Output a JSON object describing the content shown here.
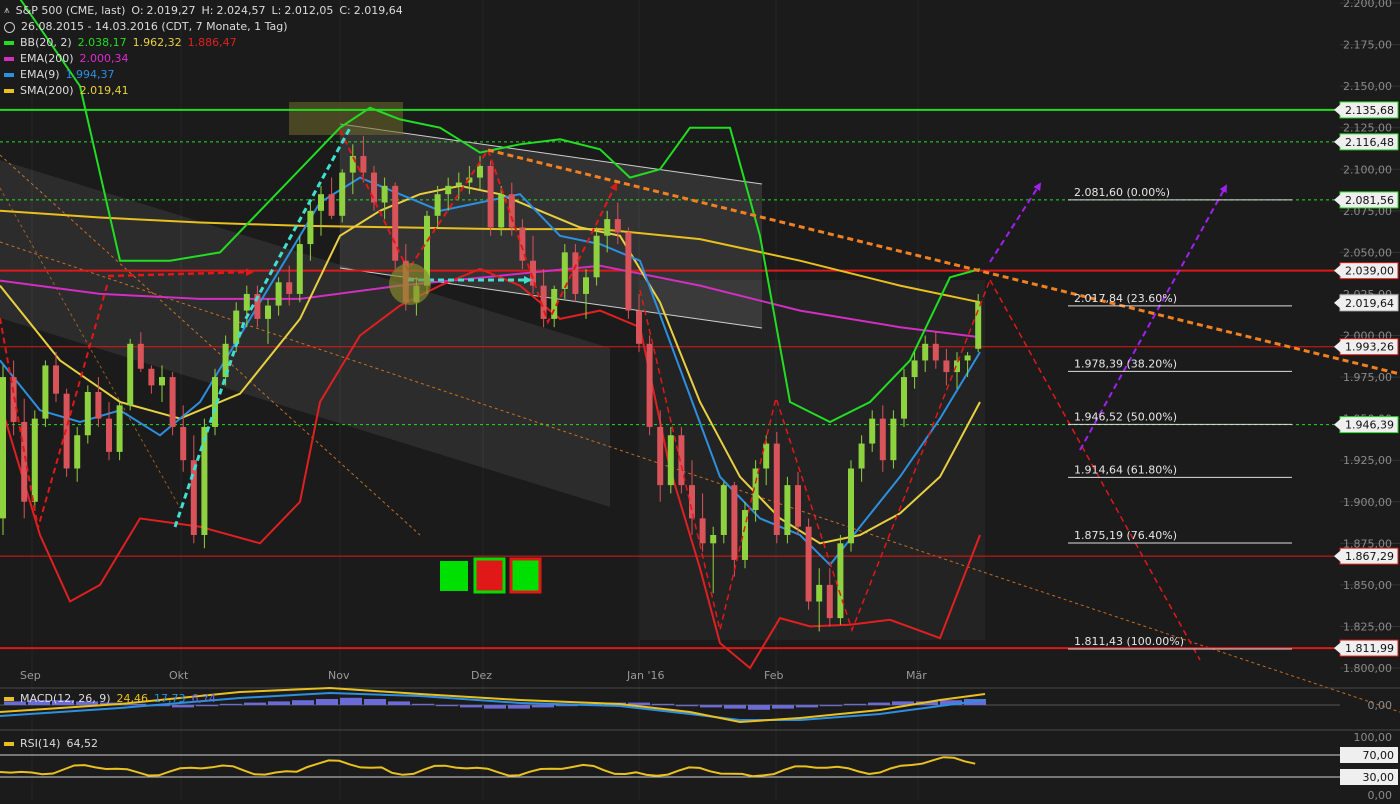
{
  "header": {
    "symbol": "S&P 500 (CME, last)",
    "o_label": "O:",
    "o": "2.019,27",
    "h_label": "H:",
    "h": "2.024,57",
    "l_label": "L:",
    "l": "2.012,05",
    "c_label": "C:",
    "c": "2.019,64",
    "range": "26.08.2015 - 14.03.2016 (CDT, 7 Monate, 1 Tag)"
  },
  "legend": [
    {
      "name": "BB(20, 2)",
      "values": [
        "2.038,17",
        "1.962,32",
        "1.886,47"
      ],
      "colors": [
        "#22dd22",
        "#e8d040",
        "#e02020"
      ],
      "color": "#22dd22"
    },
    {
      "name": "EMA(200)",
      "values": [
        "2.000,34"
      ],
      "colors": [
        "#e02bd0"
      ],
      "color": "#d22fc2"
    },
    {
      "name": "EMA(9)",
      "values": [
        "1.994,37"
      ],
      "colors": [
        "#2d8fe0"
      ],
      "color": "#2d8fe0"
    },
    {
      "name": "SMA(200)",
      "values": [
        "2.019,41"
      ],
      "colors": [
        "#e8d040"
      ],
      "color": "#e8c020"
    }
  ],
  "price_axis": {
    "ticks": [
      "2.200,00",
      "2.175,00",
      "2.150,00",
      "2.125,00",
      "2.100,00",
      "2.075,00",
      "2.050,00",
      "2.025,00",
      "2.000,00",
      "1.975,00",
      "1.950,00",
      "1.925,00",
      "1.900,00",
      "1.875,00",
      "1.850,00",
      "1.825,00",
      "1.800,00"
    ],
    "tick_values": [
      2200,
      2175,
      2150,
      2125,
      2100,
      2075,
      2050,
      2025,
      2000,
      1975,
      1950,
      1925,
      1900,
      1875,
      1850,
      1825,
      1800
    ]
  },
  "price_tags": [
    {
      "value": 2135.68,
      "label": "2.135,68"
    },
    {
      "value": 2116.48,
      "label": "2.116,48"
    },
    {
      "value": 2081.56,
      "label": "2.081,56"
    },
    {
      "value": 2039.0,
      "label": "2.039,00"
    },
    {
      "value": 2019.64,
      "label": "2.019,64"
    },
    {
      "value": 1993.26,
      "label": "1.993,26"
    },
    {
      "value": 1946.39,
      "label": "1.946,39"
    },
    {
      "value": 1867.29,
      "label": "1.867,29"
    },
    {
      "value": 1811.99,
      "label": "1.811,99"
    }
  ],
  "fib_levels": [
    {
      "value": 2081.6,
      "label": "2.081,60 (0.00%)"
    },
    {
      "value": 2017.84,
      "label": "2.017,84 (23.60%)"
    },
    {
      "value": 1978.39,
      "label": "1.978,39 (38.20%)"
    },
    {
      "value": 1946.52,
      "label": "1.946,52 (50.00%)"
    },
    {
      "value": 1914.64,
      "label": "1.914,64 (61.80%)"
    },
    {
      "value": 1875.19,
      "label": "1.875,19 (76.40%)"
    },
    {
      "value": 1811.43,
      "label": "1.811,43 (100.00%)"
    }
  ],
  "time_axis": [
    "Sep",
    "Okt",
    "Nov",
    "Dez",
    "Jan '16",
    "Feb",
    "Mär"
  ],
  "macd": {
    "label": "MACD(12, 26, 9)",
    "values": [
      "24,46",
      "17,73",
      "6,74"
    ],
    "colors": [
      "#e8c020",
      "#2d8fe0",
      "#6b6bd8"
    ],
    "zero_label": "0,00"
  },
  "rsi": {
    "label": "RSI(14)",
    "value": "64,52",
    "levels": [
      "100,00",
      "70,00",
      "30,00",
      "0,00"
    ],
    "color": "#e8c020"
  },
  "colors": {
    "background": "#1b1b1b",
    "up": "#8fd23f",
    "down": "#d9535a",
    "bb": "#22dd22",
    "bb_mid": "#e8d040",
    "bb_low": "#e02020",
    "ema200": "#d22fc2",
    "ema9": "#2d8fe0",
    "sma200": "#e8c020",
    "support": "#e01818",
    "fib_arrow": "#a020f0",
    "trend": "#f08020",
    "cyan": "#40e0d0"
  },
  "chart_data": {
    "type": "candlestick",
    "ylim": [
      1790,
      2200
    ],
    "candles": [
      [
        1890,
        1982,
        1880,
        1975
      ],
      [
        1975,
        1985,
        1940,
        1948
      ],
      [
        1948,
        1962,
        1890,
        1900
      ],
      [
        1900,
        1955,
        1895,
        1950
      ],
      [
        1950,
        1985,
        1945,
        1982
      ],
      [
        1982,
        1990,
        1960,
        1965
      ],
      [
        1965,
        1968,
        1915,
        1920
      ],
      [
        1920,
        1945,
        1912,
        1940
      ],
      [
        1940,
        1970,
        1935,
        1966
      ],
      [
        1966,
        1975,
        1945,
        1950
      ],
      [
        1950,
        1960,
        1925,
        1930
      ],
      [
        1930,
        1960,
        1925,
        1958
      ],
      [
        1958,
        1998,
        1955,
        1995
      ],
      [
        1995,
        2002,
        1978,
        1980
      ],
      [
        1980,
        1982,
        1965,
        1970
      ],
      [
        1970,
        1982,
        1960,
        1975
      ],
      [
        1975,
        1978,
        1940,
        1945
      ],
      [
        1945,
        1958,
        1918,
        1925
      ],
      [
        1925,
        1940,
        1875,
        1880
      ],
      [
        1880,
        1950,
        1872,
        1945
      ],
      [
        1945,
        1980,
        1940,
        1975
      ],
      [
        1975,
        2000,
        1970,
        1995
      ],
      [
        1995,
        2020,
        1990,
        2015
      ],
      [
        2015,
        2030,
        2005,
        2025
      ],
      [
        2025,
        2030,
        2005,
        2010
      ],
      [
        2010,
        2022,
        1995,
        2018
      ],
      [
        2018,
        2035,
        2012,
        2032
      ],
      [
        2032,
        2042,
        2018,
        2025
      ],
      [
        2025,
        2060,
        2020,
        2055
      ],
      [
        2055,
        2080,
        2045,
        2075
      ],
      [
        2075,
        2090,
        2060,
        2085
      ],
      [
        2085,
        2095,
        2070,
        2072
      ],
      [
        2072,
        2100,
        2068,
        2098
      ],
      [
        2098,
        2115,
        2085,
        2108
      ],
      [
        2108,
        2120,
        2092,
        2098
      ],
      [
        2098,
        2102,
        2075,
        2080
      ],
      [
        2080,
        2095,
        2070,
        2090
      ],
      [
        2090,
        2092,
        2040,
        2045
      ],
      [
        2045,
        2055,
        2015,
        2020
      ],
      [
        2020,
        2035,
        2012,
        2030
      ],
      [
        2030,
        2075,
        2025,
        2072
      ],
      [
        2072,
        2090,
        2065,
        2085
      ],
      [
        2085,
        2095,
        2075,
        2090
      ],
      [
        2090,
        2098,
        2082,
        2092
      ],
      [
        2092,
        2102,
        2085,
        2095
      ],
      [
        2095,
        2108,
        2088,
        2102
      ],
      [
        2102,
        2105,
        2060,
        2065
      ],
      [
        2065,
        2090,
        2060,
        2085
      ],
      [
        2085,
        2092,
        2060,
        2065
      ],
      [
        2065,
        2070,
        2040,
        2045
      ],
      [
        2045,
        2060,
        2025,
        2030
      ],
      [
        2030,
        2040,
        2005,
        2010
      ],
      [
        2010,
        2030,
        2005,
        2028
      ],
      [
        2028,
        2055,
        2022,
        2050
      ],
      [
        2050,
        2055,
        2020,
        2025
      ],
      [
        2025,
        2040,
        2010,
        2035
      ],
      [
        2035,
        2065,
        2030,
        2060
      ],
      [
        2060,
        2075,
        2050,
        2070
      ],
      [
        2070,
        2080,
        2055,
        2062
      ],
      [
        2062,
        2065,
        2010,
        2015
      ],
      [
        2015,
        2025,
        1990,
        1995
      ],
      [
        1995,
        2000,
        1940,
        1945
      ],
      [
        1945,
        1955,
        1900,
        1910
      ],
      [
        1910,
        1945,
        1905,
        1940
      ],
      [
        1940,
        1945,
        1905,
        1910
      ],
      [
        1910,
        1925,
        1880,
        1890
      ],
      [
        1890,
        1905,
        1870,
        1875
      ],
      [
        1875,
        1885,
        1845,
        1880
      ],
      [
        1880,
        1912,
        1875,
        1910
      ],
      [
        1910,
        1912,
        1855,
        1865
      ],
      [
        1865,
        1900,
        1860,
        1895
      ],
      [
        1895,
        1925,
        1888,
        1920
      ],
      [
        1920,
        1940,
        1910,
        1935
      ],
      [
        1935,
        1942,
        1875,
        1880
      ],
      [
        1880,
        1915,
        1875,
        1910
      ],
      [
        1910,
        1918,
        1880,
        1885
      ],
      [
        1885,
        1890,
        1835,
        1840
      ],
      [
        1840,
        1860,
        1822,
        1850
      ],
      [
        1850,
        1860,
        1825,
        1830
      ],
      [
        1830,
        1880,
        1826,
        1875
      ],
      [
        1875,
        1925,
        1870,
        1920
      ],
      [
        1920,
        1940,
        1912,
        1935
      ],
      [
        1935,
        1955,
        1930,
        1950
      ],
      [
        1950,
        1958,
        1918,
        1925
      ],
      [
        1925,
        1955,
        1920,
        1950
      ],
      [
        1950,
        1980,
        1945,
        1975
      ],
      [
        1975,
        1990,
        1968,
        1985
      ],
      [
        1985,
        2000,
        1978,
        1995
      ],
      [
        1995,
        2002,
        1980,
        1985
      ],
      [
        1985,
        1992,
        1970,
        1978
      ],
      [
        1978,
        1990,
        1968,
        1985
      ],
      [
        1985,
        1990,
        1975,
        1988
      ],
      [
        1992,
        2025,
        1990,
        2020
      ]
    ],
    "bb_upper": [
      [
        0,
        2220
      ],
      [
        80,
        2150
      ],
      [
        120,
        2045
      ],
      [
        170,
        2045
      ],
      [
        220,
        2050
      ],
      [
        260,
        2075
      ],
      [
        300,
        2100
      ],
      [
        340,
        2125
      ],
      [
        370,
        2137
      ],
      [
        400,
        2130
      ],
      [
        440,
        2125
      ],
      [
        480,
        2110
      ],
      [
        520,
        2115
      ],
      [
        560,
        2118
      ],
      [
        600,
        2112
      ],
      [
        630,
        2095
      ],
      [
        660,
        2100
      ],
      [
        690,
        2125
      ],
      [
        730,
        2125
      ],
      [
        760,
        2060
      ],
      [
        790,
        1960
      ],
      [
        830,
        1948
      ],
      [
        870,
        1960
      ],
      [
        910,
        1985
      ],
      [
        950,
        2035
      ],
      [
        980,
        2040
      ]
    ],
    "bb_lower": [
      [
        0,
        1960
      ],
      [
        40,
        1880
      ],
      [
        70,
        1840
      ],
      [
        100,
        1850
      ],
      [
        140,
        1890
      ],
      [
        200,
        1885
      ],
      [
        260,
        1875
      ],
      [
        300,
        1900
      ],
      [
        320,
        1960
      ],
      [
        360,
        2000
      ],
      [
        400,
        2018
      ],
      [
        440,
        2030
      ],
      [
        480,
        2040
      ],
      [
        520,
        2030
      ],
      [
        560,
        2010
      ],
      [
        600,
        2015
      ],
      [
        640,
        2005
      ],
      [
        670,
        1920
      ],
      [
        700,
        1860
      ],
      [
        720,
        1815
      ],
      [
        750,
        1800
      ],
      [
        780,
        1830
      ],
      [
        810,
        1825
      ],
      [
        850,
        1826
      ],
      [
        890,
        1829
      ],
      [
        940,
        1818
      ],
      [
        980,
        1880
      ]
    ],
    "bb_middle": [
      [
        0,
        2030
      ],
      [
        60,
        1985
      ],
      [
        120,
        1960
      ],
      [
        180,
        1950
      ],
      [
        240,
        1965
      ],
      [
        300,
        2010
      ],
      [
        340,
        2060
      ],
      [
        380,
        2075
      ],
      [
        420,
        2085
      ],
      [
        460,
        2090
      ],
      [
        500,
        2085
      ],
      [
        540,
        2075
      ],
      [
        580,
        2065
      ],
      [
        620,
        2060
      ],
      [
        660,
        2020
      ],
      [
        700,
        1960
      ],
      [
        740,
        1915
      ],
      [
        780,
        1890
      ],
      [
        820,
        1875
      ],
      [
        860,
        1880
      ],
      [
        900,
        1893
      ],
      [
        940,
        1915
      ],
      [
        980,
        1960
      ]
    ],
    "ema9": [
      [
        0,
        1985
      ],
      [
        40,
        1955
      ],
      [
        80,
        1948
      ],
      [
        120,
        1955
      ],
      [
        160,
        1940
      ],
      [
        200,
        1960
      ],
      [
        240,
        2000
      ],
      [
        280,
        2040
      ],
      [
        320,
        2080
      ],
      [
        360,
        2095
      ],
      [
        400,
        2085
      ],
      [
        440,
        2075
      ],
      [
        480,
        2080
      ],
      [
        520,
        2085
      ],
      [
        560,
        2060
      ],
      [
        600,
        2055
      ],
      [
        640,
        2045
      ],
      [
        680,
        1980
      ],
      [
        720,
        1915
      ],
      [
        760,
        1890
      ],
      [
        800,
        1880
      ],
      [
        830,
        1862
      ],
      [
        860,
        1885
      ],
      [
        900,
        1915
      ],
      [
        940,
        1950
      ],
      [
        980,
        1990
      ]
    ],
    "ema200": [
      [
        0,
        2033
      ],
      [
        100,
        2025
      ],
      [
        200,
        2022
      ],
      [
        300,
        2022
      ],
      [
        400,
        2030
      ],
      [
        500,
        2036
      ],
      [
        600,
        2042
      ],
      [
        700,
        2030
      ],
      [
        800,
        2015
      ],
      [
        900,
        2005
      ],
      [
        980,
        1999
      ]
    ],
    "sma200": [
      [
        0,
        2075
      ],
      [
        100,
        2071
      ],
      [
        200,
        2068
      ],
      [
        300,
        2066
      ],
      [
        400,
        2065
      ],
      [
        500,
        2064
      ],
      [
        600,
        2064
      ],
      [
        700,
        2058
      ],
      [
        800,
        2045
      ],
      [
        900,
        2030
      ],
      [
        980,
        2020
      ]
    ]
  }
}
